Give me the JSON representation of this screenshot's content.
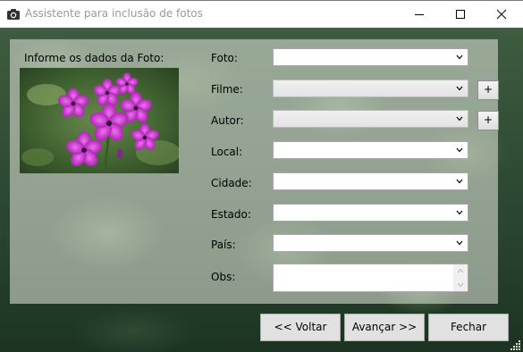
{
  "window": {
    "title": "Assistente para inclusão de fotos",
    "icon": "camera-icon"
  },
  "panel": {
    "title": "Informe os dados da Foto:"
  },
  "fields": {
    "foto": {
      "label": "Foto:",
      "value": ""
    },
    "filme": {
      "label": "Filme:",
      "value": ""
    },
    "autor": {
      "label": "Autor:",
      "value": ""
    },
    "local": {
      "label": "Local:",
      "value": ""
    },
    "cidade": {
      "label": "Cidade:",
      "value": ""
    },
    "estado": {
      "label": "Estado:",
      "value": ""
    },
    "pais": {
      "label": "País:",
      "value": ""
    },
    "obs": {
      "label": "Obs:",
      "value": ""
    }
  },
  "add_label": "+",
  "buttons": {
    "voltar": "<< Voltar",
    "avancar": "Avançar >>",
    "fechar": "Fechar"
  },
  "colors": {
    "panel": "#dce2d6",
    "button": "#e1e1e1",
    "flower": "#b22ab8"
  }
}
